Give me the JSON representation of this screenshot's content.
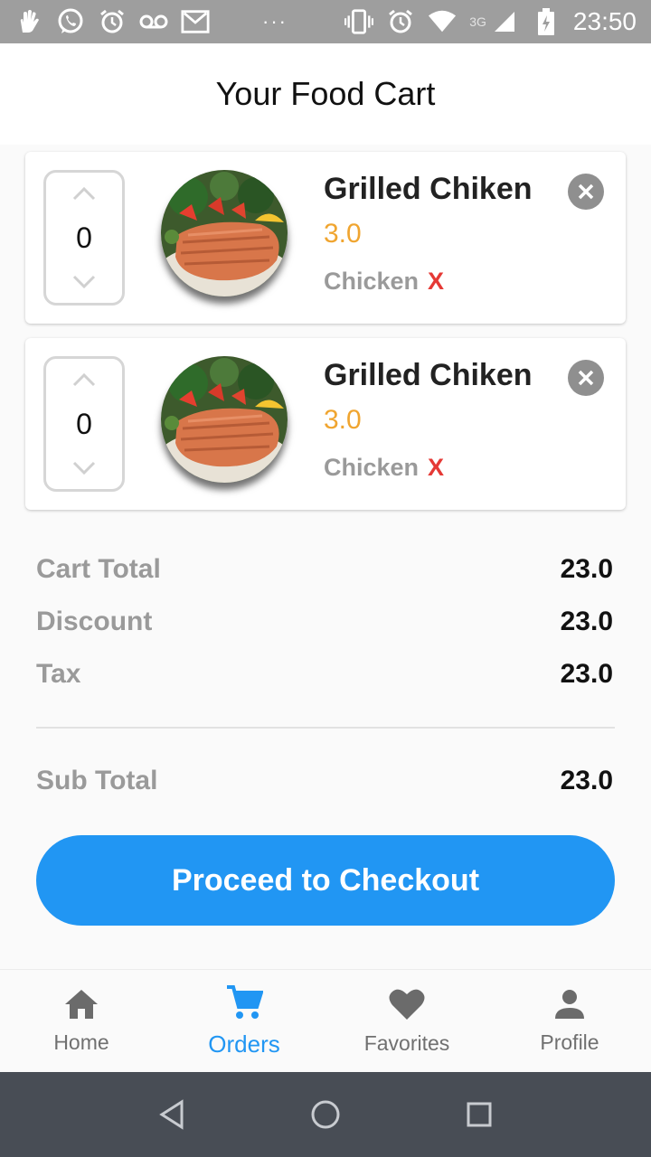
{
  "status_bar": {
    "time": "23:50",
    "network": "3G",
    "dots": "···",
    "left_icons": [
      "hand-icon",
      "whatsapp-icon",
      "alarm-icon",
      "voicemail-icon",
      "gmail-icon"
    ],
    "right_icons": [
      "vibrate-icon",
      "alarm-icon",
      "wifi-icon",
      "signal-icon",
      "battery-icon"
    ]
  },
  "header": {
    "title": "Your Food Cart"
  },
  "cart": {
    "items": [
      {
        "quantity": "0",
        "name": "Grilled Chiken",
        "price": "3.0",
        "category": "Chicken",
        "category_mark": "X"
      },
      {
        "quantity": "0",
        "name": "Grilled Chiken",
        "price": "3.0",
        "category": "Chicken",
        "category_mark": "X"
      }
    ]
  },
  "summary": {
    "cart_total_label": "Cart Total",
    "cart_total_value": "23.0",
    "discount_label": "Discount",
    "discount_value": "23.0",
    "tax_label": "Tax",
    "tax_value": "23.0",
    "subtotal_label": "Sub Total",
    "subtotal_value": "23.0"
  },
  "checkout": {
    "label": "Proceed to Checkout"
  },
  "bottom_nav": {
    "items": [
      {
        "label": "Home",
        "icon": "home-icon",
        "active": false
      },
      {
        "label": "Orders",
        "icon": "cart-icon",
        "active": true
      },
      {
        "label": "Favorites",
        "icon": "heart-icon",
        "active": false
      },
      {
        "label": "Profile",
        "icon": "person-icon",
        "active": false
      }
    ]
  },
  "colors": {
    "accent": "#2196f3",
    "price": "#f0a530",
    "category_x": "#e53935",
    "status_bar": "#9e9e9e",
    "system_nav": "#484d55"
  }
}
